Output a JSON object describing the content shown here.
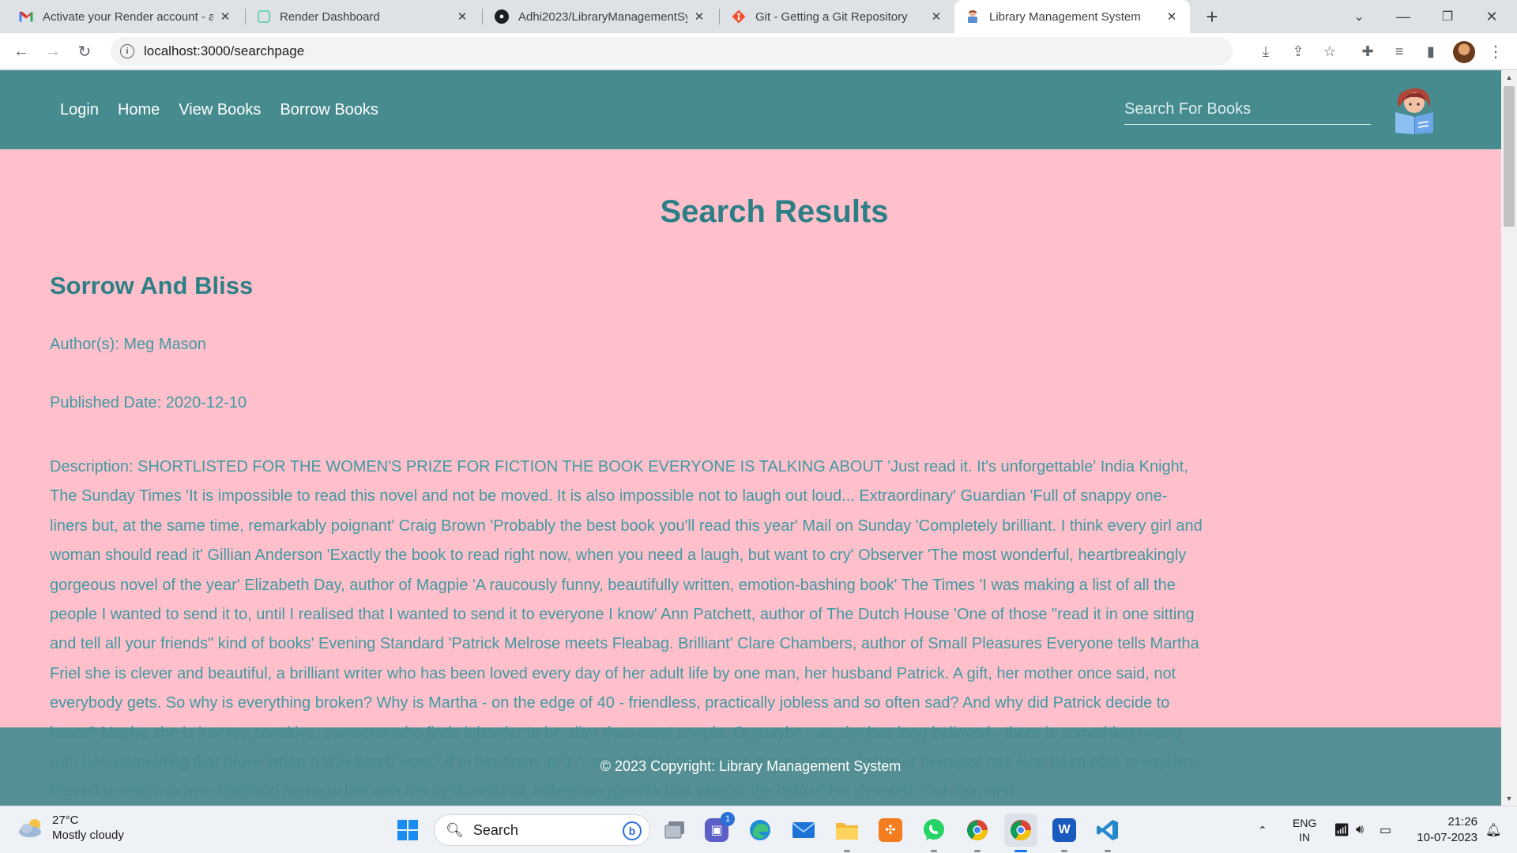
{
  "browser": {
    "tabs": [
      {
        "title": "Activate your Render account - a",
        "icon": "gmail-icon"
      },
      {
        "title": "Render Dashboard",
        "icon": "render-icon"
      },
      {
        "title": "Adhi2023/LibraryManagementSy",
        "icon": "github-icon"
      },
      {
        "title": "Git - Getting a Git Repository",
        "icon": "git-icon"
      },
      {
        "title": "Library Management System",
        "icon": "library-icon",
        "active": true
      }
    ],
    "url": "localhost:3000/searchpage"
  },
  "site": {
    "nav": {
      "login": "Login",
      "home": "Home",
      "view_books": "View Books",
      "borrow_books": "Borrow Books"
    },
    "search_placeholder": "Search For Books",
    "heading": "Search Results",
    "book": {
      "title": "Sorrow And Bliss",
      "authors": "Author(s): Meg Mason",
      "published": "Published Date: 2020-12-10",
      "description": "Description: SHORTLISTED FOR THE WOMEN'S PRIZE FOR FICTION THE BOOK EVERYONE IS TALKING ABOUT 'Just read it. It's unforgettable' India Knight, The Sunday Times 'It is impossible to read this novel and not be moved. It is also impossible not to laugh out loud... Extraordinary' Guardian 'Full of snappy one-liners but, at the same time, remarkably poignant' Craig Brown 'Probably the best book you'll read this year' Mail on Sunday 'Completely brilliant. I think every girl and woman should read it' Gillian Anderson 'Exactly the book to read right now, when you need a laugh, but want to cry' Observer 'The most wonderful, heartbreakingly gorgeous novel of the year' Elizabeth Day, author of Magpie 'A raucously funny, beautifully written, emotion-bashing book' The Times 'I was making a list of all the people I wanted to send it to, until I realised that I wanted to send it to everyone I know' Ann Patchett, author of The Dutch House 'One of those \"read it in one sitting and tell all your friends\" kind of books' Evening Standard 'Patrick Melrose meets Fleabag. Brilliant' Clare Chambers, author of Small Pleasures Everyone tells Martha Friel she is clever and beautiful, a brilliant writer who has been loved every day of her adult life by one man, her husband Patrick. A gift, her mother once said, not everybody gets. So why is everything broken? Why is Martha - on the edge of 40 - friendless, practically jobless and so often sad? And why did Patrick decide to leave? Maybe she is just too sensitive, someone who finds it harder to be alive than most people. Or maybe - as she has long believed - there is something wrong with her. Something that broke when a little bomb went off in her brain, at 17, and left her changed in a way that no doctor or therapist has ever been able to explain. Forced to return to her childhood home to live with her dysfunctional, bohemian parents (but without the help of her devoted, foul-mouthed"
    },
    "footer": "© 2023 Copyright: Library Management System"
  },
  "taskbar": {
    "weather_temp": "27°C",
    "weather_desc": "Mostly cloudy",
    "search_label": "Search",
    "teams_badge": "1",
    "lang_top": "ENG",
    "lang_bottom": "IN",
    "time": "21:26",
    "date": "10-07-2023"
  },
  "colors": {
    "page_bg": "#ffc0cb",
    "nav_bg": "#468b8e",
    "heading": "#2d7f86",
    "text": "#3f9aa2"
  }
}
